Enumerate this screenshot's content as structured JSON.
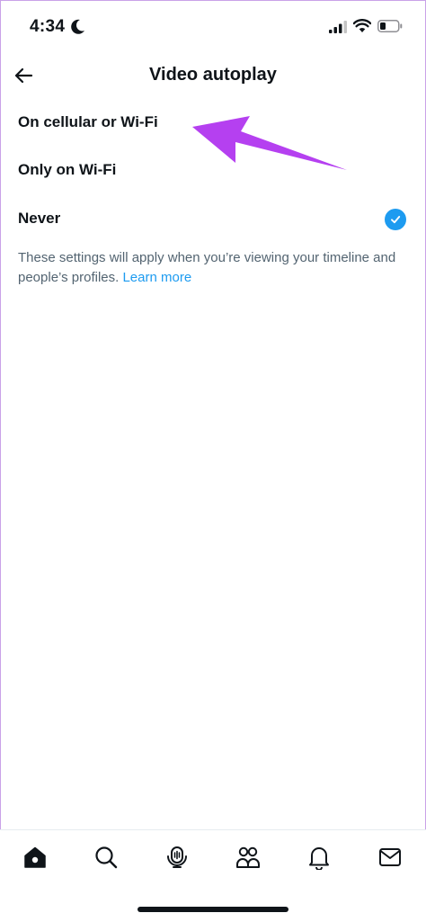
{
  "status_bar": {
    "time": "4:34"
  },
  "header": {
    "title": "Video autoplay"
  },
  "options": [
    {
      "label": "On cellular or Wi-Fi",
      "selected": false
    },
    {
      "label": "Only on Wi-Fi",
      "selected": false
    },
    {
      "label": "Never",
      "selected": true
    }
  ],
  "note": {
    "text": "These settings will apply when you’re viewing your timeline and people’s profiles.",
    "link": "Learn more"
  },
  "colors": {
    "accent": "#1d9bf0",
    "annotation": "#b540f0",
    "muted": "#536471"
  },
  "tabbar": {
    "icons": [
      "home-icon",
      "search-icon",
      "spaces-icon",
      "communities-icon",
      "notifications-icon",
      "messages-icon"
    ]
  }
}
